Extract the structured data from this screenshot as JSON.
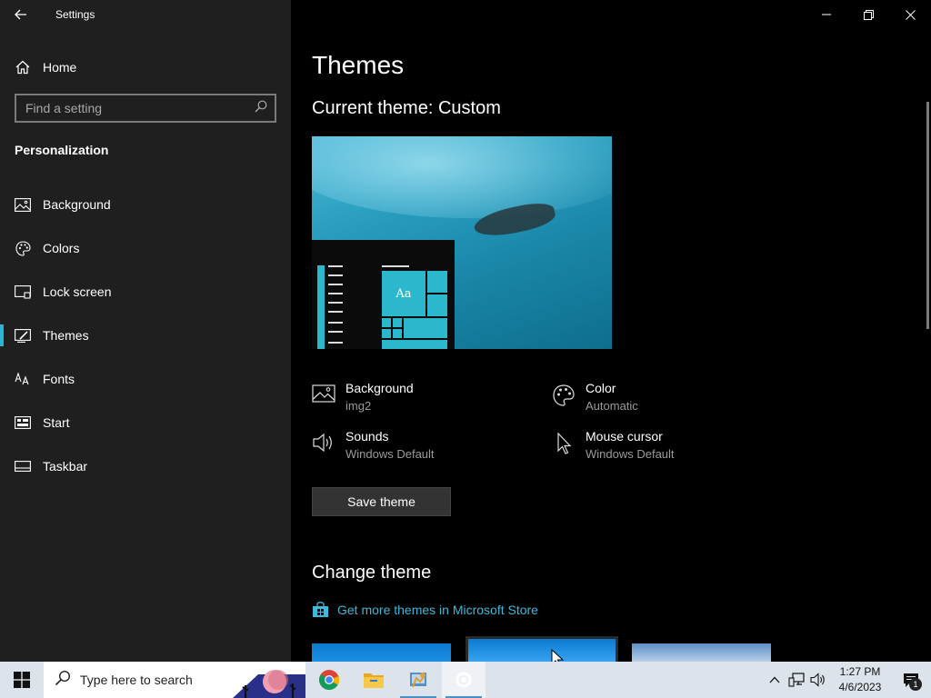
{
  "window": {
    "app_title": "Settings",
    "controls": {
      "minimize": "minimize-icon",
      "restore": "restore-icon",
      "close": "close-icon"
    }
  },
  "sidebar": {
    "home_label": "Home",
    "search_placeholder": "Find a setting",
    "section_title": "Personalization",
    "items": [
      {
        "label": "Background",
        "icon": "picture-icon",
        "active": false
      },
      {
        "label": "Colors",
        "icon": "palette-icon",
        "active": false
      },
      {
        "label": "Lock screen",
        "icon": "lock-screen-icon",
        "active": false
      },
      {
        "label": "Themes",
        "icon": "themes-icon",
        "active": true
      },
      {
        "label": "Fonts",
        "icon": "fonts-icon",
        "active": false
      },
      {
        "label": "Start",
        "icon": "start-icon",
        "active": false
      },
      {
        "label": "Taskbar",
        "icon": "taskbar-icon",
        "active": false
      }
    ]
  },
  "main": {
    "page_title": "Themes",
    "current_theme": "Current theme: Custom",
    "preview_tile_text": "Aa",
    "properties": {
      "background": {
        "title": "Background",
        "value": "img2"
      },
      "color": {
        "title": "Color",
        "value": "Automatic"
      },
      "sounds": {
        "title": "Sounds",
        "value": "Windows Default"
      },
      "mouse_cursor": {
        "title": "Mouse cursor",
        "value": "Windows Default"
      }
    },
    "save_button": "Save theme",
    "change_theme_title": "Change theme",
    "store_link": "Get more themes in Microsoft Store"
  },
  "taskbar": {
    "search_placeholder": "Type here to search",
    "apps": [
      "chrome-icon",
      "file-explorer-icon",
      "control-panel-icon",
      "settings-icon"
    ],
    "time": "1:27 PM",
    "date": "4/6/2023",
    "notification_count": "1"
  },
  "colors": {
    "accent": "#29b6d3",
    "link": "#3fb8d9",
    "sidebar_bg": "#1f1f1f",
    "taskbar_bg": "#dce3ea"
  }
}
